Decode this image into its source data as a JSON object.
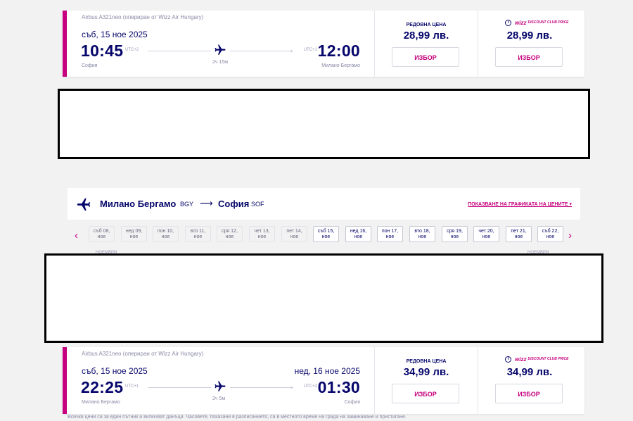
{
  "flight1": {
    "aircraft": "Airbus A321neo (опериран от Wizz Air Hungary)",
    "dep_date": "съб, 15 ное 2025",
    "arr_date": "",
    "dep_time": "10:45",
    "dep_tz": "UTC+2",
    "arr_time": "12:00",
    "arr_tz": "UTC+1",
    "duration": "2ч 15м",
    "dep_city": "София",
    "arr_city": "Милано Бергамо",
    "regular_label": "РЕДОВНА ЦЕНА",
    "regular_price": "28,99 лв.",
    "club_price": "28,99 лв.",
    "select_label": "ИЗБОР"
  },
  "club_badge": {
    "brand": "wizz",
    "line": "DISCOUNT CLUB PRICE",
    "info": "i"
  },
  "return_header": {
    "from_city": "Милано Бергамо",
    "from_code": "BGY",
    "arrow": "⟶",
    "to_city": "София",
    "to_code": "SOF",
    "price_graph_link": "ПОКАЗВАНЕ НА ГРАФИКАТА НА ЦЕНИТЕ ▾"
  },
  "date_strip": {
    "prev": "‹",
    "next": "›",
    "month_left": "НОЕМВРИ",
    "month_right": "НОЕМВРИ",
    "dates": [
      {
        "day": "съб 08,",
        "month": "ное",
        "enabled": false
      },
      {
        "day": "нед 09,",
        "month": "ное",
        "enabled": false
      },
      {
        "day": "пон 10,",
        "month": "ное",
        "enabled": false
      },
      {
        "day": "вто 11,",
        "month": "ное",
        "enabled": false
      },
      {
        "day": "сря 12,",
        "month": "ное",
        "enabled": false
      },
      {
        "day": "чет 13,",
        "month": "ное",
        "enabled": false
      },
      {
        "day": "пет 14,",
        "month": "ное",
        "enabled": false
      },
      {
        "day": "съб 15,",
        "month": "ное",
        "enabled": true
      },
      {
        "day": "нед 16,",
        "month": "ное",
        "enabled": true
      },
      {
        "day": "пон 17,",
        "month": "ное",
        "enabled": true
      },
      {
        "day": "вто 18,",
        "month": "ное",
        "enabled": true
      },
      {
        "day": "сря 19,",
        "month": "ное",
        "enabled": true
      },
      {
        "day": "чет 20,",
        "month": "ное",
        "enabled": true
      },
      {
        "day": "пет 21,",
        "month": "ное",
        "enabled": true
      },
      {
        "day": "съб 22,",
        "month": "ное",
        "enabled": true
      }
    ]
  },
  "flight2": {
    "aircraft": "Airbus A321neo (опериран от Wizz Air Hungary)",
    "dep_date": "съб, 15 ное 2025",
    "arr_date": "нед, 16 ное 2025",
    "dep_time": "22:25",
    "dep_tz": "UTC+1",
    "arr_time": "01:30",
    "arr_tz": "UTC+2",
    "duration": "2ч 5м",
    "dep_city": "Милано Бергамо",
    "arr_city": "София",
    "regular_label": "РЕДОВНА ЦЕНА",
    "regular_price": "34,99 лв.",
    "club_price": "34,99 лв.",
    "select_label": "ИЗБОР"
  },
  "footnote": "Всички цени са за един пътник и включват данъци. Часовете, показани в разписанието, са в местното време на града на заминаване и пристигане.",
  "colors": {
    "accent": "#c6007e",
    "navy": "#06066b"
  }
}
